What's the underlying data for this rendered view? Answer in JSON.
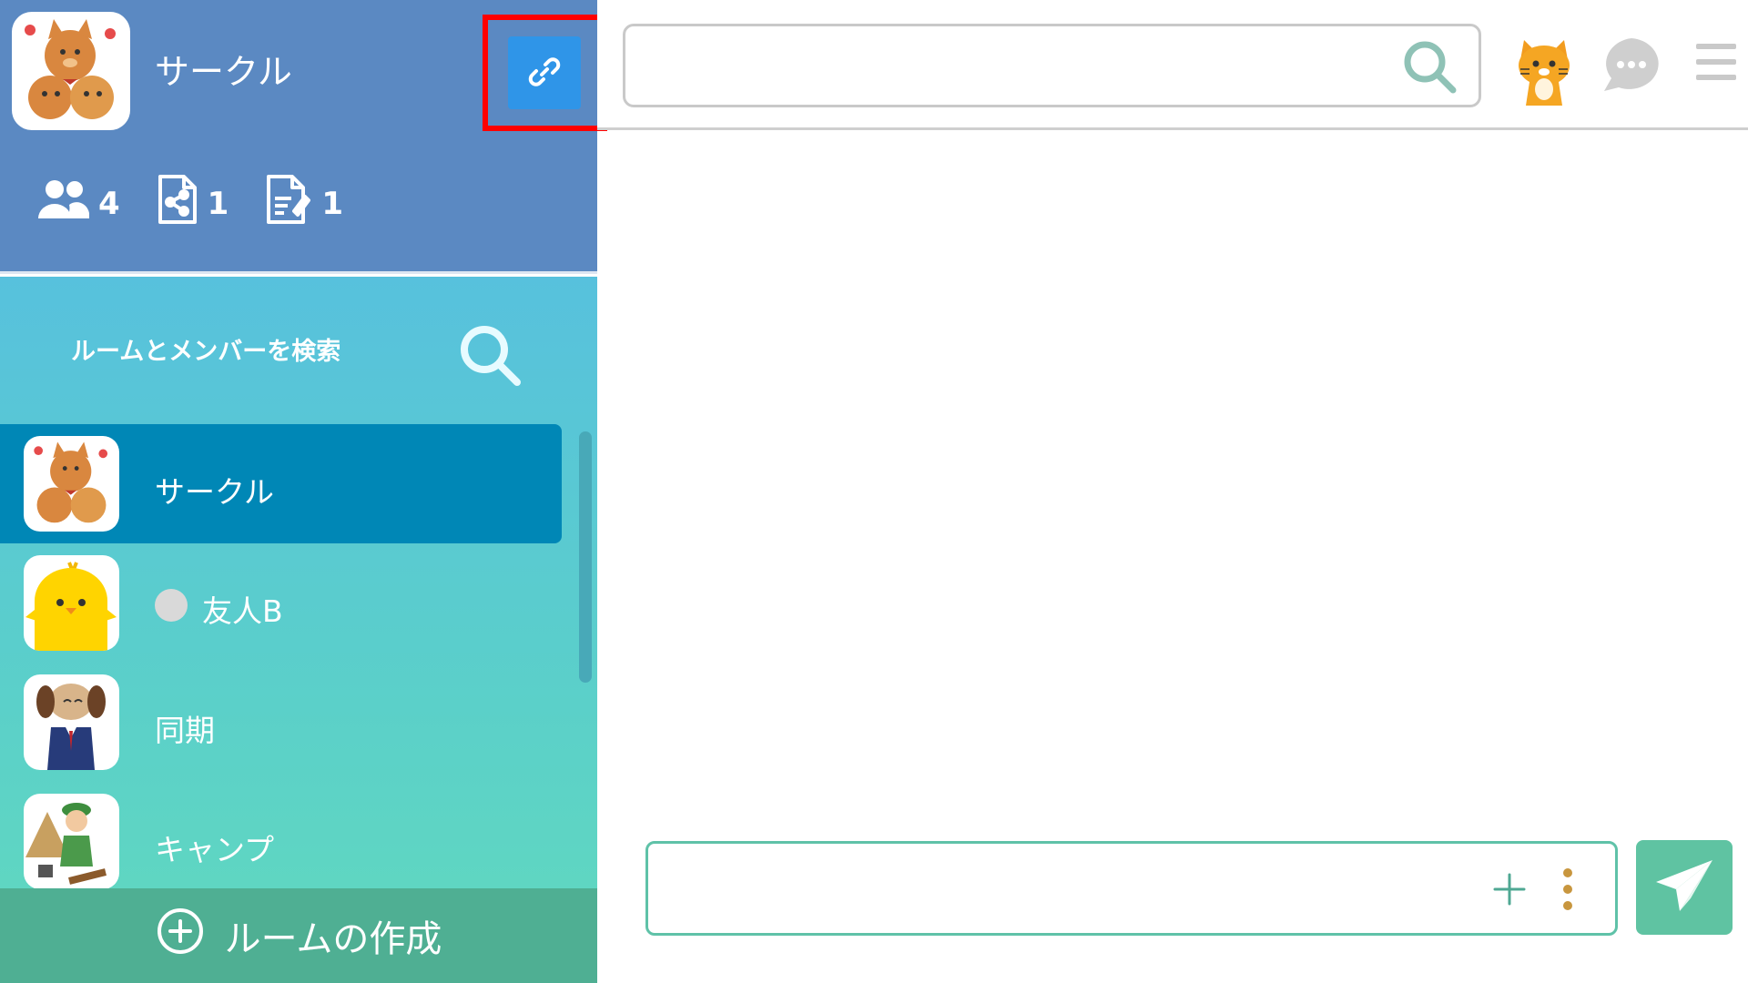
{
  "group": {
    "name": "サークル",
    "avatar": "dogs-celebrating-avatar",
    "stats": [
      {
        "icon": "members-icon",
        "count": "4"
      },
      {
        "icon": "shared-file-icon",
        "count": "1"
      },
      {
        "icon": "note-icon",
        "count": "1"
      }
    ],
    "link_button_icon": "link-icon"
  },
  "sidebar": {
    "search_label": "ルームとメンバーを検索",
    "rooms": [
      {
        "name": "サークル",
        "avatar": "dogs-celebrating-avatar",
        "active": true
      },
      {
        "name": "友人B",
        "avatar": "chick-avatar",
        "status": "offline"
      },
      {
        "name": "同期",
        "avatar": "dog-businessman-avatar"
      },
      {
        "name": "キャンプ",
        "avatar": "camper-avatar"
      }
    ],
    "create_room_label": "ルームの作成"
  },
  "topbar": {
    "search_placeholder": "",
    "icons": [
      "search-icon",
      "cat-icon",
      "chat-bubble-icon",
      "hamburger-menu-icon"
    ]
  },
  "composer": {
    "placeholder": "",
    "icons": [
      "plus-icon",
      "more-vertical-icon",
      "send-icon"
    ]
  },
  "colors": {
    "header_blue": "#5b89c2",
    "link_button": "#2f95e8",
    "active_room": "#0087b6",
    "create_room_bar": "#4faf93",
    "send_button": "#5fc3a2",
    "highlight": "#ff0000"
  }
}
